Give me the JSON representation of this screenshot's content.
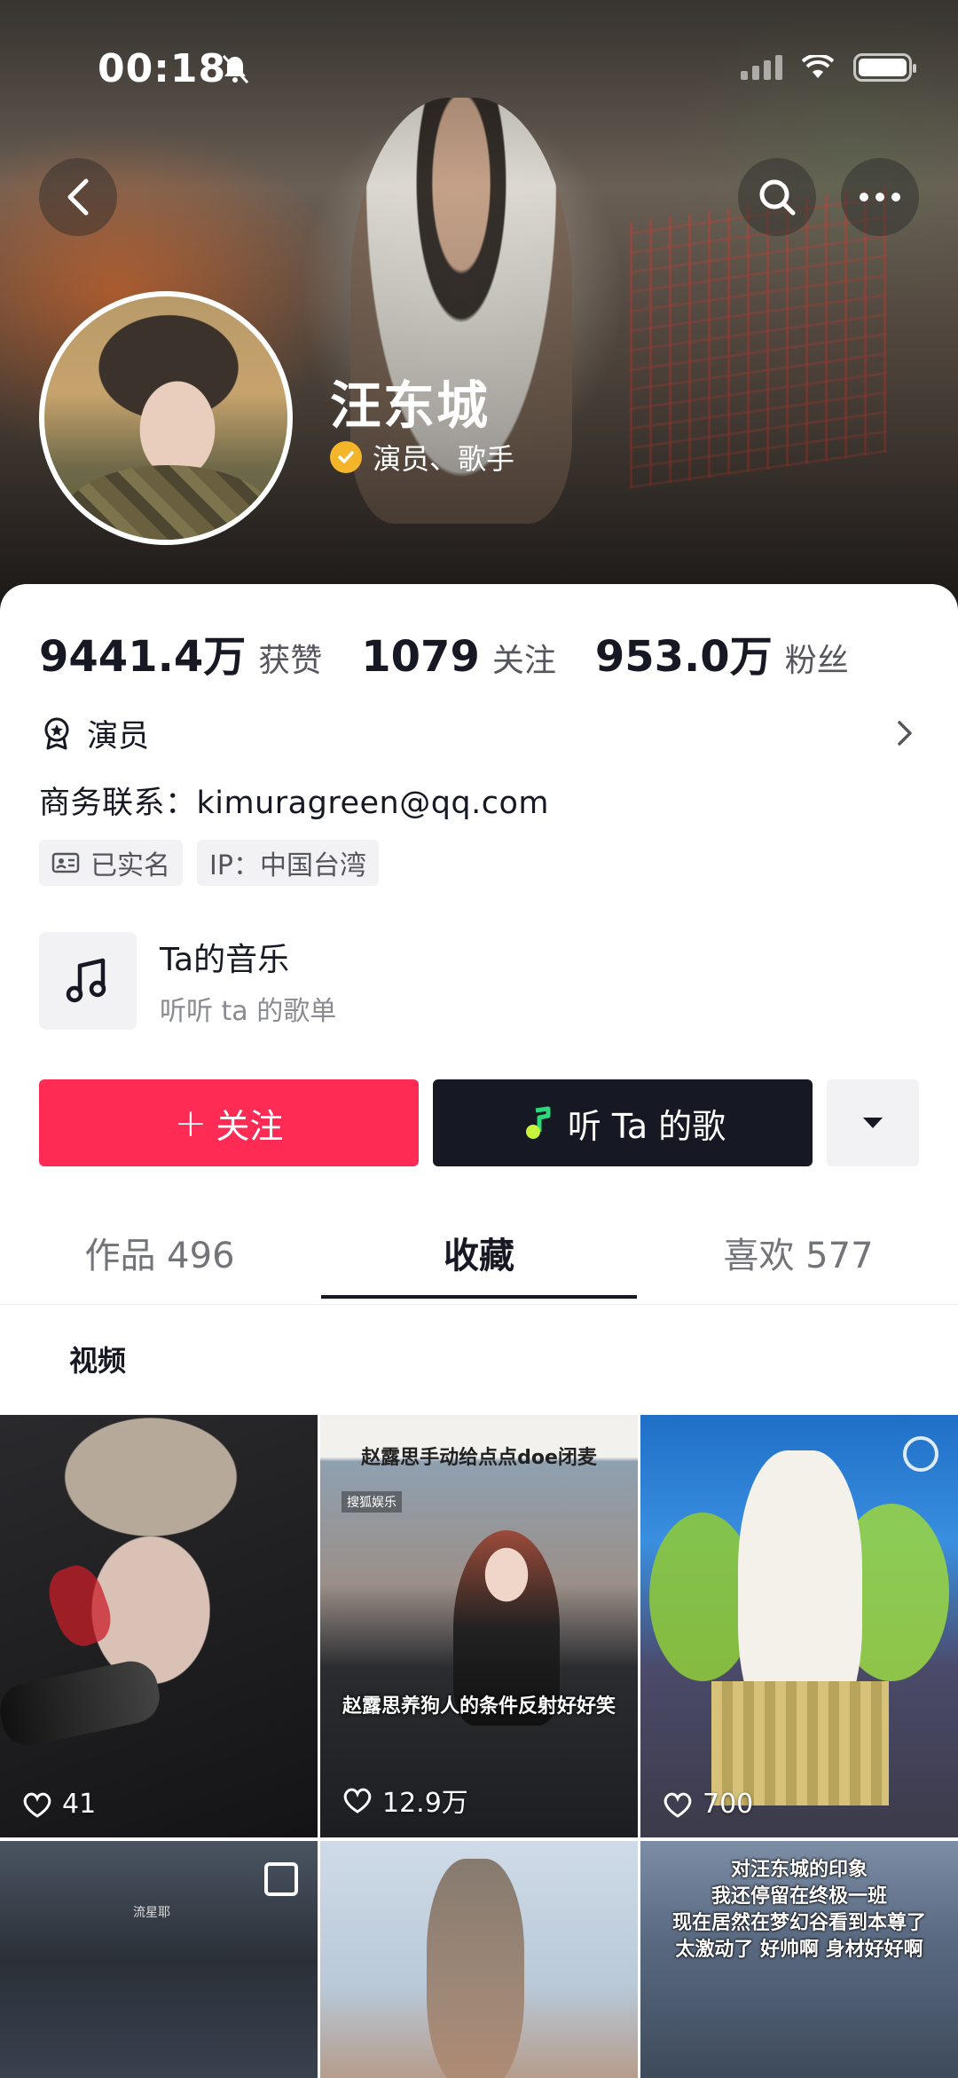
{
  "status": {
    "time": "00:18"
  },
  "profile": {
    "name": "汪东城",
    "verified_title": "演员、歌手",
    "stats": [
      {
        "value": "9441.4万",
        "label": "获赞"
      },
      {
        "value": "1079",
        "label": "关注"
      },
      {
        "value": "953.0万",
        "label": "粉丝"
      }
    ],
    "occupation": "演员",
    "contact": "商务联系：kimuragreen@qq.com",
    "tags": [
      "已实名",
      "IP：中国台湾"
    ]
  },
  "music": {
    "title": "Ta的音乐",
    "subtitle": "听听 ta 的歌单"
  },
  "actions": {
    "follow_label": "关注",
    "listen_label": "听 Ta 的歌"
  },
  "tabs": [
    {
      "label": "作品 496",
      "active": false
    },
    {
      "label": "收藏",
      "active": true
    },
    {
      "label": "喜欢 577",
      "active": false
    }
  ],
  "section": {
    "label": "视频"
  },
  "videos": [
    {
      "likes": "41"
    },
    {
      "likes": "12.9万",
      "top_caption": "赵露思手动给点点doe闭麦",
      "sub_caption": "搜狐娱乐",
      "bottom_caption": "赵露思养狗人的条件反射好好笑"
    },
    {
      "likes": "700"
    },
    {
      "side_label": "流星耶"
    },
    {},
    {
      "caption_lines": [
        "对汪东城的印象",
        "我还停留在终极一班",
        "现在居然在梦幻谷看到本尊了",
        "太激动了 好帅啊 身材好好啊"
      ]
    }
  ],
  "colors": {
    "accent": "#fe2c55",
    "dark_button": "#161823",
    "verified": "#f5b52a"
  }
}
